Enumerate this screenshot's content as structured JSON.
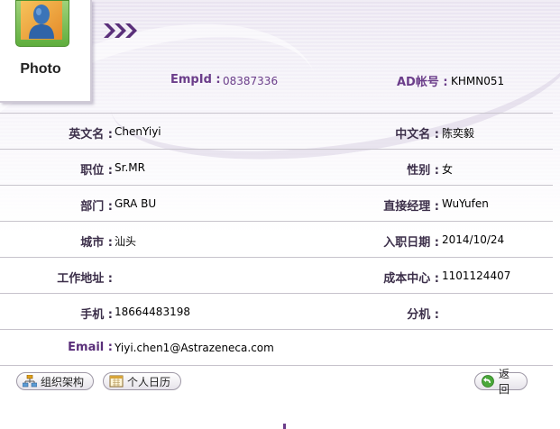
{
  "photo": {
    "label": "Photo"
  },
  "header": {
    "empid_label": "EmpId :",
    "empid_value": "08387336",
    "ad_label": "AD帐号 :",
    "ad_value": "KHMN051"
  },
  "rows": [
    {
      "left_label": "英文名 :",
      "left_value": "ChenYiyi",
      "right_label": "中文名 :",
      "right_value": "陈奕毅"
    },
    {
      "left_label": "职位 :",
      "left_value": "Sr.MR",
      "right_label": "性别 :",
      "right_value": "女"
    },
    {
      "left_label": "部门 :",
      "left_value": "GRA BU",
      "right_label": "直接经理 :",
      "right_value": "WuYufen"
    },
    {
      "left_label": "城市 :",
      "left_value": "汕头",
      "right_label": "入职日期 :",
      "right_value": "2014/10/24"
    },
    {
      "left_label": "工作地址 :",
      "left_value": "",
      "right_label": "成本中心 :",
      "right_value": "1101124407"
    },
    {
      "left_label": "手机 :",
      "left_value": "18664483198",
      "right_label": "分机 :",
      "right_value": ""
    }
  ],
  "email": {
    "label": "Email :",
    "value": "Yiyi.chen1@Astrazeneca.com"
  },
  "buttons": {
    "org": "组织架构",
    "calendar": "个人日历",
    "back": "返回"
  },
  "icons": {
    "photo": "person-photo-icon",
    "chevrons": "triple-chevron-right-icon",
    "org": "org-chart-icon",
    "calendar": "calendar-icon",
    "back": "back-arrow-icon"
  },
  "colors": {
    "accent": "#6b3d8a",
    "line": "#c7c3cc"
  }
}
